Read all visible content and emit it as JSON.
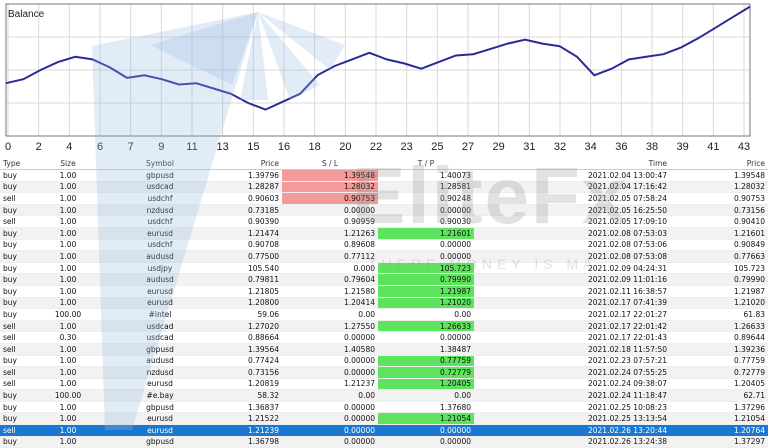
{
  "chart": {
    "title": "Balance",
    "line_color": "#2a2a9a",
    "grid_color": "#d9d9d9",
    "x_ticks": [
      "0",
      "2",
      "4",
      "6",
      "7",
      "9",
      "11",
      "13",
      "15",
      "16",
      "18",
      "20",
      "22",
      "23",
      "25",
      "27",
      "29",
      "31",
      "32",
      "34",
      "36",
      "38",
      "39",
      "41",
      "43"
    ],
    "balance_points": [
      [
        0,
        0.4
      ],
      [
        1,
        0.43
      ],
      [
        2,
        0.5
      ],
      [
        3,
        0.56
      ],
      [
        4,
        0.6
      ],
      [
        5,
        0.58
      ],
      [
        6,
        0.52
      ],
      [
        7,
        0.44
      ],
      [
        8,
        0.46
      ],
      [
        9,
        0.43
      ],
      [
        10,
        0.39
      ],
      [
        11,
        0.4
      ],
      [
        12,
        0.36
      ],
      [
        13,
        0.32
      ],
      [
        14,
        0.25
      ],
      [
        15,
        0.2
      ],
      [
        16,
        0.26
      ],
      [
        17,
        0.32
      ],
      [
        18,
        0.46
      ],
      [
        19,
        0.53
      ],
      [
        20,
        0.58
      ],
      [
        21,
        0.63
      ],
      [
        22,
        0.58
      ],
      [
        23,
        0.55
      ],
      [
        24,
        0.51
      ],
      [
        25,
        0.56
      ],
      [
        26,
        0.61
      ],
      [
        27,
        0.62
      ],
      [
        28,
        0.66
      ],
      [
        29,
        0.7
      ],
      [
        30,
        0.73
      ],
      [
        31,
        0.7
      ],
      [
        32,
        0.68
      ],
      [
        33,
        0.6
      ],
      [
        34,
        0.46
      ],
      [
        35,
        0.51
      ],
      [
        36,
        0.58
      ],
      [
        37,
        0.6
      ],
      [
        38,
        0.62
      ],
      [
        39,
        0.67
      ],
      [
        40,
        0.74
      ],
      [
        41,
        0.82
      ],
      [
        42,
        0.9
      ],
      [
        43,
        0.98
      ]
    ]
  },
  "watermark": {
    "brand": "EliteFx",
    "tagline": "THERE MONEY IS MA"
  },
  "table": {
    "columns": [
      "Type",
      "Size",
      "Symbol",
      "Price",
      "S / L",
      "T / P",
      "Time",
      "Price"
    ],
    "rows": [
      {
        "type": "buy",
        "size": "1.00",
        "symbol": "gbpusd",
        "price": "1.39796",
        "sl": "1.39548",
        "tp": "1.40073",
        "time": "2021.02.04 13:00:47",
        "close": "1.39548",
        "sl_hit": true,
        "tp_hit": false,
        "selected": false
      },
      {
        "type": "buy",
        "size": "1.00",
        "symbol": "usdcad",
        "price": "1.28287",
        "sl": "1.28032",
        "tp": "1.28581",
        "time": "2021.02.04 17:16:42",
        "close": "1.28032",
        "sl_hit": true,
        "tp_hit": false,
        "selected": false
      },
      {
        "type": "sell",
        "size": "1.00",
        "symbol": "usdchf",
        "price": "0.90603",
        "sl": "0.90753",
        "tp": "0.90248",
        "time": "2021.02.05 07:58:24",
        "close": "0.90753",
        "sl_hit": true,
        "tp_hit": false,
        "selected": false
      },
      {
        "type": "buy",
        "size": "1.00",
        "symbol": "nzdusd",
        "price": "0.73185",
        "sl": "0.00000",
        "tp": "0.00000",
        "time": "2021.02.05 16:25:50",
        "close": "0.73156",
        "sl_hit": false,
        "tp_hit": false,
        "selected": false
      },
      {
        "type": "sell",
        "size": "1.00",
        "symbol": "usdchf",
        "price": "0.90390",
        "sl": "0.90959",
        "tp": "0.90030",
        "time": "2021.02.05 17:09:10",
        "close": "0.90410",
        "sl_hit": false,
        "tp_hit": false,
        "selected": false
      },
      {
        "type": "buy",
        "size": "1.00",
        "symbol": "eurusd",
        "price": "1.21474",
        "sl": "1.21263",
        "tp": "1.21601",
        "time": "2021.02.08 07:53:03",
        "close": "1.21601",
        "sl_hit": false,
        "tp_hit": true,
        "selected": false
      },
      {
        "type": "buy",
        "size": "1.00",
        "symbol": "usdchf",
        "price": "0.90708",
        "sl": "0.89608",
        "tp": "0.00000",
        "time": "2021.02.08 07:53:06",
        "close": "0.90849",
        "sl_hit": false,
        "tp_hit": false,
        "selected": false
      },
      {
        "type": "buy",
        "size": "1.00",
        "symbol": "audusd",
        "price": "0.77500",
        "sl": "0.77112",
        "tp": "0.00000",
        "time": "2021.02.08 07:53:08",
        "close": "0.77663",
        "sl_hit": false,
        "tp_hit": false,
        "selected": false
      },
      {
        "type": "buy",
        "size": "1.00",
        "symbol": "usdjpy",
        "price": "105.540",
        "sl": "0.000",
        "tp": "105.723",
        "time": "2021.02.09 04:24:31",
        "close": "105.723",
        "sl_hit": false,
        "tp_hit": true,
        "selected": false
      },
      {
        "type": "buy",
        "size": "1.00",
        "symbol": "audusd",
        "price": "0.79811",
        "sl": "0.79604",
        "tp": "0.79990",
        "time": "2021.02.09 11:01:16",
        "close": "0.79990",
        "sl_hit": false,
        "tp_hit": true,
        "selected": false
      },
      {
        "type": "buy",
        "size": "1.00",
        "symbol": "eurusd",
        "price": "1.21805",
        "sl": "1.21580",
        "tp": "1.21987",
        "time": "2021.02.11 16:38:57",
        "close": "1.21987",
        "sl_hit": false,
        "tp_hit": true,
        "selected": false
      },
      {
        "type": "buy",
        "size": "1.00",
        "symbol": "eurusd",
        "price": "1.20800",
        "sl": "1.20414",
        "tp": "1.21020",
        "time": "2021.02.17 07:41:39",
        "close": "1.21020",
        "sl_hit": false,
        "tp_hit": true,
        "selected": false
      },
      {
        "type": "buy",
        "size": "100.00",
        "symbol": "#intel",
        "price": "59.06",
        "sl": "0.00",
        "tp": "0.00",
        "time": "2021.02.17 22:01:27",
        "close": "61.83",
        "sl_hit": false,
        "tp_hit": false,
        "selected": false
      },
      {
        "type": "sell",
        "size": "1.00",
        "symbol": "usdcad",
        "price": "1.27020",
        "sl": "1.27550",
        "tp": "1.26633",
        "time": "2021.02.17 22:01:42",
        "close": "1.26633",
        "sl_hit": false,
        "tp_hit": true,
        "selected": false
      },
      {
        "type": "sell",
        "size": "0.30",
        "symbol": "usdcad",
        "price": "0.88664",
        "sl": "0.00000",
        "tp": "0.00000",
        "time": "2021.02.17 22:01:43",
        "close": "0.89644",
        "sl_hit": false,
        "tp_hit": false,
        "selected": false
      },
      {
        "type": "sell",
        "size": "1.00",
        "symbol": "gbpusd",
        "price": "1.39564",
        "sl": "1.40580",
        "tp": "1.38487",
        "time": "2021.02.18 11:57:50",
        "close": "1.39236",
        "sl_hit": false,
        "tp_hit": false,
        "selected": false
      },
      {
        "type": "buy",
        "size": "1.00",
        "symbol": "audusd",
        "price": "0.77424",
        "sl": "0.00000",
        "tp": "0.77759",
        "time": "2021.02.23 07:57:21",
        "close": "0.77759",
        "sl_hit": false,
        "tp_hit": true,
        "selected": false
      },
      {
        "type": "sell",
        "size": "1.00",
        "symbol": "nzdusd",
        "price": "0.73156",
        "sl": "0.00000",
        "tp": "0.72779",
        "time": "2021.02.24 07:55:25",
        "close": "0.72779",
        "sl_hit": false,
        "tp_hit": true,
        "selected": false
      },
      {
        "type": "sell",
        "size": "1.00",
        "symbol": "eurusd",
        "price": "1.20819",
        "sl": "1.21237",
        "tp": "1.20405",
        "time": "2021.02.24 09:38:07",
        "close": "1.20405",
        "sl_hit": false,
        "tp_hit": true,
        "selected": false
      },
      {
        "type": "buy",
        "size": "100.00",
        "symbol": "#e.bay",
        "price": "58.32",
        "sl": "0.00",
        "tp": "0.00",
        "time": "2021.02.24 11:18:47",
        "close": "62.71",
        "sl_hit": false,
        "tp_hit": false,
        "selected": false
      },
      {
        "type": "buy",
        "size": "1.00",
        "symbol": "gbpusd",
        "price": "1.36837",
        "sl": "0.00000",
        "tp": "1.37680",
        "time": "2021.02.25 10:08:23",
        "close": "1.37296",
        "sl_hit": false,
        "tp_hit": false,
        "selected": false
      },
      {
        "type": "buy",
        "size": "1.00",
        "symbol": "eurusd",
        "price": "1.21522",
        "sl": "0.00000",
        "tp": "1.21054",
        "time": "2021.02.25 13:13:54",
        "close": "1.21054",
        "sl_hit": false,
        "tp_hit": true,
        "selected": false
      },
      {
        "type": "sell",
        "size": "1.00",
        "symbol": "eurusd",
        "price": "1.21239",
        "sl": "0.00000",
        "tp": "0.00000",
        "time": "2021.02.26 13:20:44",
        "close": "1.20764",
        "sl_hit": false,
        "tp_hit": false,
        "selected": true
      },
      {
        "type": "buy",
        "size": "1.00",
        "symbol": "gbpusd",
        "price": "1.36798",
        "sl": "0.00000",
        "tp": "0.00000",
        "time": "2021.02.26 13:24:38",
        "close": "1.37297",
        "sl_hit": false,
        "tp_hit": false,
        "selected": false
      }
    ]
  }
}
